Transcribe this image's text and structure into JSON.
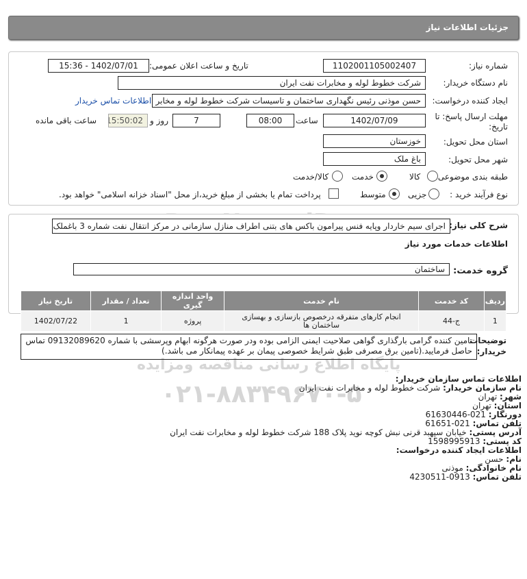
{
  "header": {
    "title": "جزئیات اطلاعات نیاز"
  },
  "form": {
    "need_number_label": "شماره نیاز:",
    "need_number": "1102001105002407",
    "announce_label": "تاریخ و ساعت اعلان عمومی:",
    "announce_value": "1402/07/01 - 15:36",
    "buyer_org_label": "نام دستگاه خریدار:",
    "buyer_org": "شرکت خطوط لوله و مخابرات نفت ایران",
    "creator_label": "ایجاد کننده درخواست:",
    "creator": "حسن  موذنی  رئیس نگهداری ساختمان و تاسیسات  شرکت خطوط لوله و مخابر",
    "contact_link": "اطلاعات تماس خریدار",
    "deadline_label_1": "مهلت ارسال پاسخ: تا",
    "deadline_label_2": "تاریخ:",
    "deadline_date": "1402/07/09",
    "time_label": "ساعت",
    "deadline_time": "08:00",
    "days": "7",
    "days_label": "روز و",
    "remaining_time": "15:50:02",
    "remaining_label": "ساعت باقی مانده",
    "province_label": "استان محل تحویل:",
    "province": "خوزستان",
    "city_label": "شهر محل تحویل:",
    "city": "باغ ملک",
    "category_label": "طبقه بندی موضوعی:",
    "category_options": [
      "کالا",
      "خدمت",
      "کالا/خدمت"
    ],
    "process_label": "نوع فرآیند خرید :",
    "process_options": [
      "جزیی",
      "متوسط"
    ],
    "payment_note": "پرداخت تمام یا بخشی از مبلغ خرید،از محل \"اسناد خزانه اسلامی\" خواهد بود."
  },
  "description": {
    "label": "شرح کلی نیاز:",
    "text": "اجرای سیم خاردار وپایه فنس پیرامون باکس های بتنی اطراف منازل سازمانی در مرکز انتقال نفت شماره 3 باغملک"
  },
  "services": {
    "section_title": "اطلاعات خدمات مورد نیاز",
    "group_label": "گروه خدمت:",
    "group": "ساختمان",
    "columns": [
      "ردیف",
      "کد خدمت",
      "نام خدمت",
      "واحد اندازه گیری",
      "تعداد / مقدار",
      "تاریخ نیاز"
    ],
    "rows": [
      {
        "index": "1",
        "code": "ج-44",
        "name": "انجام کارهای متفرقه درخصوص بازسازی و بهسازی ساختمان ها",
        "unit": "پروژه",
        "qty": "1",
        "date": "1402/07/22"
      }
    ]
  },
  "notes": {
    "label_1": "توضیحات",
    "label_2": "خریدار:",
    "text": "تامین کننده گرامی بارگذاری گواهی صلاحیت ایمنی الزامی بوده ودر صورت هرگونه ابهام وپرسشی با شماره 09132089620 تماس حاصل فرمایید.(تامین برق مصرفی طبق شرایط خصوصی پیمان بر عهده پیمانکار می باشد.)"
  },
  "buyer_contact": {
    "title": "اطلاعات تماس سازمان خریدار:",
    "org_label": "نام سازمان خریدار:",
    "org": "شرکت خطوط لوله و مخابرات نفت ایران",
    "city_label": "شهر:",
    "city": "تهران",
    "province_label": "استان:",
    "province": "تهران",
    "fax_label": "دورنگار:",
    "fax": "021-61630446",
    "phone_label": "تلفن تماس:",
    "phone": "021-61651",
    "address_label": "آدرس پستی:",
    "address": "خیابان سپهبد قرنی نبش کوچه نوید پلاک 188 شرکت خطوط لوله و مخابرات نفت ایران",
    "postal_label": "کد پستی:",
    "postal": "1598995913"
  },
  "creator_contact": {
    "title": "اطلاعات ایجاد کننده درخواست:",
    "name_label": "نام:",
    "name": "حسن",
    "family_label": "نام خانوادگی:",
    "family": "موذنی",
    "phone_label": "تلفن تماس:",
    "phone": "0913-4230511"
  },
  "watermark": {
    "brand": "ParsNamadData",
    "line1": "پایگاه اطلاع رسانی مناقصه ومزایده",
    "phone": "۰۲۱-۸۸۳۴۹۶۷۰-۵"
  }
}
